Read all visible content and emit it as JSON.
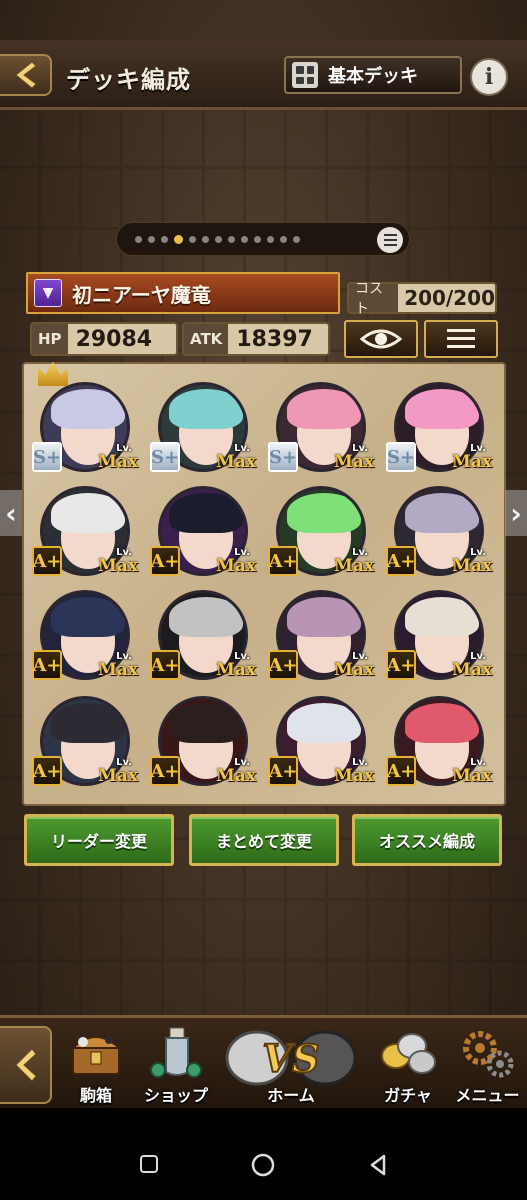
{
  "header": {
    "title": "デッキ編成",
    "deck_name": "基本デッキ"
  },
  "pager": {
    "total": 13,
    "active_index": 3
  },
  "deck": {
    "name": "初ニアーヤ魔竜",
    "cost_label": "コスト",
    "cost_value": "200/200",
    "hp_label": "HP",
    "hp_value": "29084",
    "atk_label": "ATK",
    "atk_value": "18397"
  },
  "cards": [
    {
      "rank": "S+",
      "lv_small": "Lv.",
      "lv": "Max",
      "hair": "#c9c9e6",
      "bg": "#3d3b55"
    },
    {
      "rank": "S+",
      "lv_small": "Lv.",
      "lv": "Max",
      "hair": "#7fd0cf",
      "bg": "#2c3a3b"
    },
    {
      "rank": "S+",
      "lv_small": "Lv.",
      "lv": "Max",
      "hair": "#ee98b4",
      "bg": "#3d2733"
    },
    {
      "rank": "S+",
      "lv_small": "Lv.",
      "lv": "Max",
      "hair": "#f39ac4",
      "bg": "#2b1e29"
    },
    {
      "rank": "A+",
      "lv_small": "Lv.",
      "lv": "Max",
      "hair": "#e8e8e8",
      "bg": "#2a2f36"
    },
    {
      "rank": "A+",
      "lv_small": "Lv.",
      "lv": "Max",
      "hair": "#1b1d2c",
      "bg": "#3b1f4d"
    },
    {
      "rank": "A+",
      "lv_small": "Lv.",
      "lv": "Max",
      "hair": "#7fe07a",
      "bg": "#263a25"
    },
    {
      "rank": "A+",
      "lv_small": "Lv.",
      "lv": "Max",
      "hair": "#b3a9c4",
      "bg": "#2d2933"
    },
    {
      "rank": "A+",
      "lv_small": "Lv.",
      "lv": "Max",
      "hair": "#2c3558",
      "bg": "#21243a"
    },
    {
      "rank": "A+",
      "lv_small": "Lv.",
      "lv": "Max",
      "hair": "#c2c2c2",
      "bg": "#1c1c1f"
    },
    {
      "rank": "A+",
      "lv_small": "Lv.",
      "lv": "Max",
      "hair": "#b995b5",
      "bg": "#2f2230"
    },
    {
      "rank": "A+",
      "lv_small": "Lv.",
      "lv": "Max",
      "hair": "#e7dfd3",
      "bg": "#2a1c2e"
    },
    {
      "rank": "A+",
      "lv_small": "Lv.",
      "lv": "Max",
      "hair": "#2e2a33",
      "bg": "#2c3546"
    },
    {
      "rank": "A+",
      "lv_small": "Lv.",
      "lv": "Max",
      "hair": "#2a1f1d",
      "bg": "#3a1717"
    },
    {
      "rank": "A+",
      "lv_small": "Lv.",
      "lv": "Max",
      "hair": "#e1e3ec",
      "bg": "#3a1d2e"
    },
    {
      "rank": "A+",
      "lv_small": "Lv.",
      "lv": "Max",
      "hair": "#e05a6b",
      "bg": "#3b1a1f"
    }
  ],
  "actions": {
    "leader": "リーダー変更",
    "bulk": "まとめて変更",
    "recommend": "オススメ編成"
  },
  "nav": {
    "box": "駒箱",
    "shop": "ショップ",
    "home": "ホーム",
    "gacha": "ガチャ",
    "menu": "メニュー",
    "vs": "VS"
  },
  "colors": {
    "accent_gold": "#d7b452",
    "button_green": "#4d9b2f",
    "deck_bar": "#a84b22"
  },
  "icons": [
    "chevron-left-icon",
    "deck-grid-icon",
    "info-icon",
    "list-icon",
    "eye-icon",
    "menu-lines-icon",
    "crown-icon",
    "bat-icon",
    "treasure-chest-icon",
    "shop-bottle-icon",
    "vs-shield-icon",
    "coins-icon",
    "gears-icon"
  ]
}
